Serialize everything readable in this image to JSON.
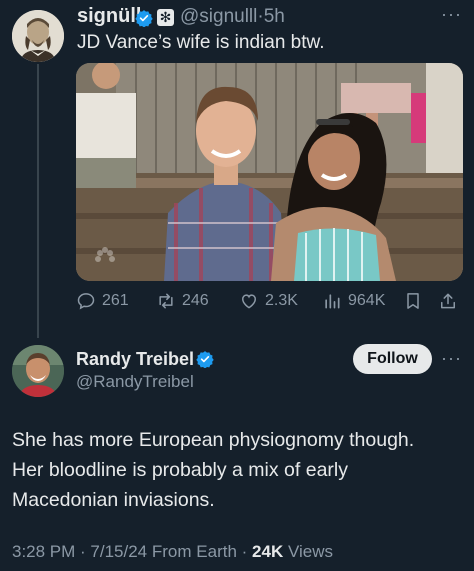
{
  "tweet": {
    "author_name": "signüll",
    "author_handle": "@signulll",
    "separator": "·",
    "age": "5h",
    "text": "JD Vance’s wife is indian btw.",
    "more_icon": "more-dots-icon",
    "actions": {
      "replies": "261",
      "reposts": "246",
      "likes": "2.3K",
      "views": "964K"
    }
  },
  "reply": {
    "author_name": "Randy Treibel",
    "author_handle": "@RandyTreibel",
    "follow_label": "Follow",
    "text_lines": [
      "She has more European physiognomy though.",
      "Her bloodline is probably a mix of early",
      "Macedonian inviasions."
    ],
    "time": "3:28 PM",
    "date": "7/15/24",
    "source": "From Earth",
    "views_count": "24K",
    "views_label": "Views"
  },
  "colors": {
    "background": "#15202b",
    "verified": "#1d9bf0",
    "muted": "#8b98a5",
    "text": "#e7e9ea"
  }
}
